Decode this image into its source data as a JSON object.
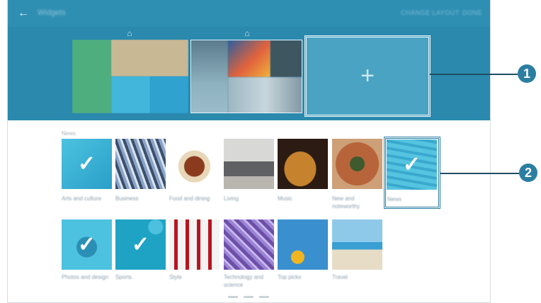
{
  "appbar": {
    "back_glyph": "←",
    "title": "Widgets",
    "change_layout": "CHANGE LAYOUT",
    "done": "DONE"
  },
  "tray": {
    "home_glyph": "⌂",
    "add_glyph": "+"
  },
  "callouts": [
    "1",
    "2"
  ],
  "section": {
    "title": "News"
  },
  "categories": [
    {
      "label": "Arts and culture",
      "checked": true
    },
    {
      "label": "Business",
      "checked": false
    },
    {
      "label": "Food and dining",
      "checked": false
    },
    {
      "label": "Living",
      "checked": false
    },
    {
      "label": "Music",
      "checked": false
    },
    {
      "label": "New and noteworthy",
      "checked": false
    },
    {
      "label": "News",
      "checked": true
    },
    {
      "label": "Photos and design",
      "checked": true
    },
    {
      "label": "Sports",
      "checked": true
    },
    {
      "label": "Style",
      "checked": false
    },
    {
      "label": "Technology and science",
      "checked": false
    },
    {
      "label": "Top picks",
      "checked": false
    },
    {
      "label": "Travel",
      "checked": false
    }
  ],
  "check_glyph": "✓",
  "colors": {
    "appbar": "#2f8fb3",
    "tray": "#2a89ad",
    "accent": "#2b7ea1",
    "check_overlay": "#3fb6d6"
  }
}
